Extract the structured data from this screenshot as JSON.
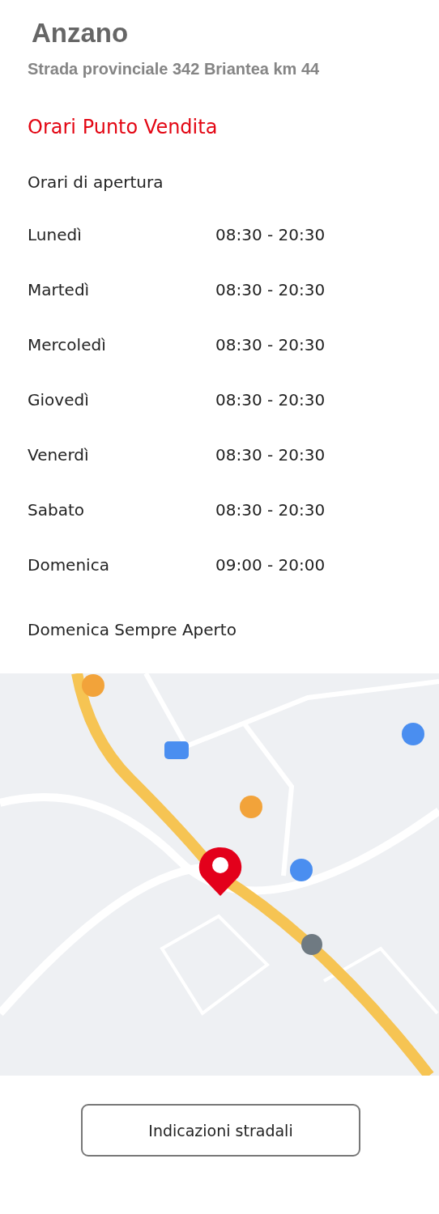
{
  "store": {
    "name": "Anzano",
    "address": "Strada provinciale 342 Briantea km 44"
  },
  "hours": {
    "title": "Orari Punto Vendita",
    "subtitle": "Orari di apertura",
    "rows": [
      {
        "day": "Lunedì",
        "time": "08:30 - 20:30"
      },
      {
        "day": "Martedì",
        "time": "08:30 - 20:30"
      },
      {
        "day": "Mercoledì",
        "time": "08:30 - 20:30"
      },
      {
        "day": "Giovedì",
        "time": "08:30 - 20:30"
      },
      {
        "day": "Venerdì",
        "time": "08:30 - 20:30"
      },
      {
        "day": "Sabato",
        "time": "08:30 - 20:30"
      },
      {
        "day": "Domenica",
        "time": "09:00 - 20:00"
      }
    ],
    "note": "Domenica Sempre Aperto"
  },
  "directions_button": {
    "label": "Indicazioni stradali"
  }
}
